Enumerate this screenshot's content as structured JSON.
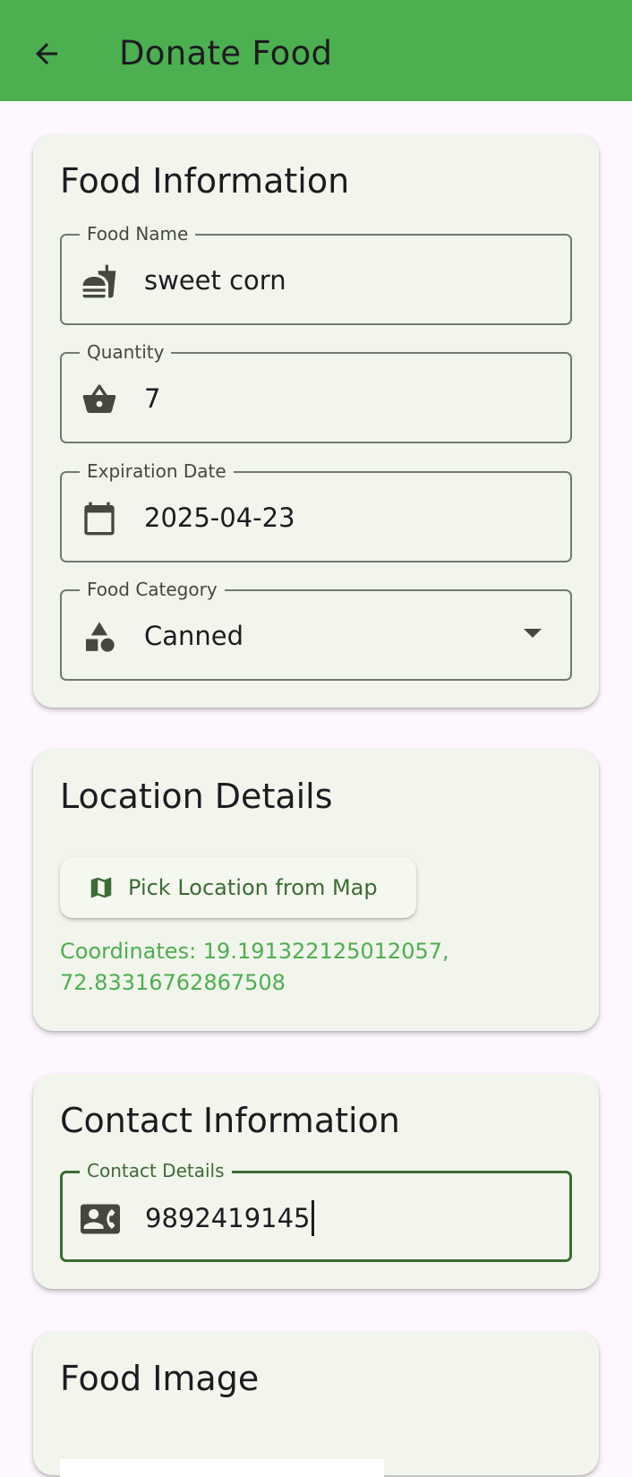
{
  "app_bar": {
    "title": "Donate Food",
    "back_icon": "arrow-back-icon",
    "color": "#4caf50"
  },
  "food_info": {
    "title": "Food Information",
    "fields": {
      "name": {
        "label": "Food Name",
        "value": "sweet corn",
        "icon": "fastfood-icon"
      },
      "quantity": {
        "label": "Quantity",
        "value": "7",
        "icon": "basket-icon"
      },
      "expiration": {
        "label": "Expiration Date",
        "value": "2025-04-23",
        "icon": "calendar-icon"
      },
      "category": {
        "label": "Food Category",
        "value": "Canned",
        "icon": "category-icon"
      }
    }
  },
  "location": {
    "title": "Location Details",
    "pick_button_label": "Pick Location from Map",
    "pick_button_icon": "map-icon",
    "coordinates_text": "Coordinates: 19.191322125012057, 72.83316762867508"
  },
  "contact": {
    "title": "Contact Information",
    "field": {
      "label": "Contact Details",
      "value": "9892419145",
      "icon": "contact-phone-icon"
    }
  },
  "food_image": {
    "title": "Food Image"
  },
  "colors": {
    "primary": "#4caf50",
    "accent_dark": "#3d6b36",
    "card_bg": "#f2f5ec",
    "page_bg": "#fef7ff"
  }
}
